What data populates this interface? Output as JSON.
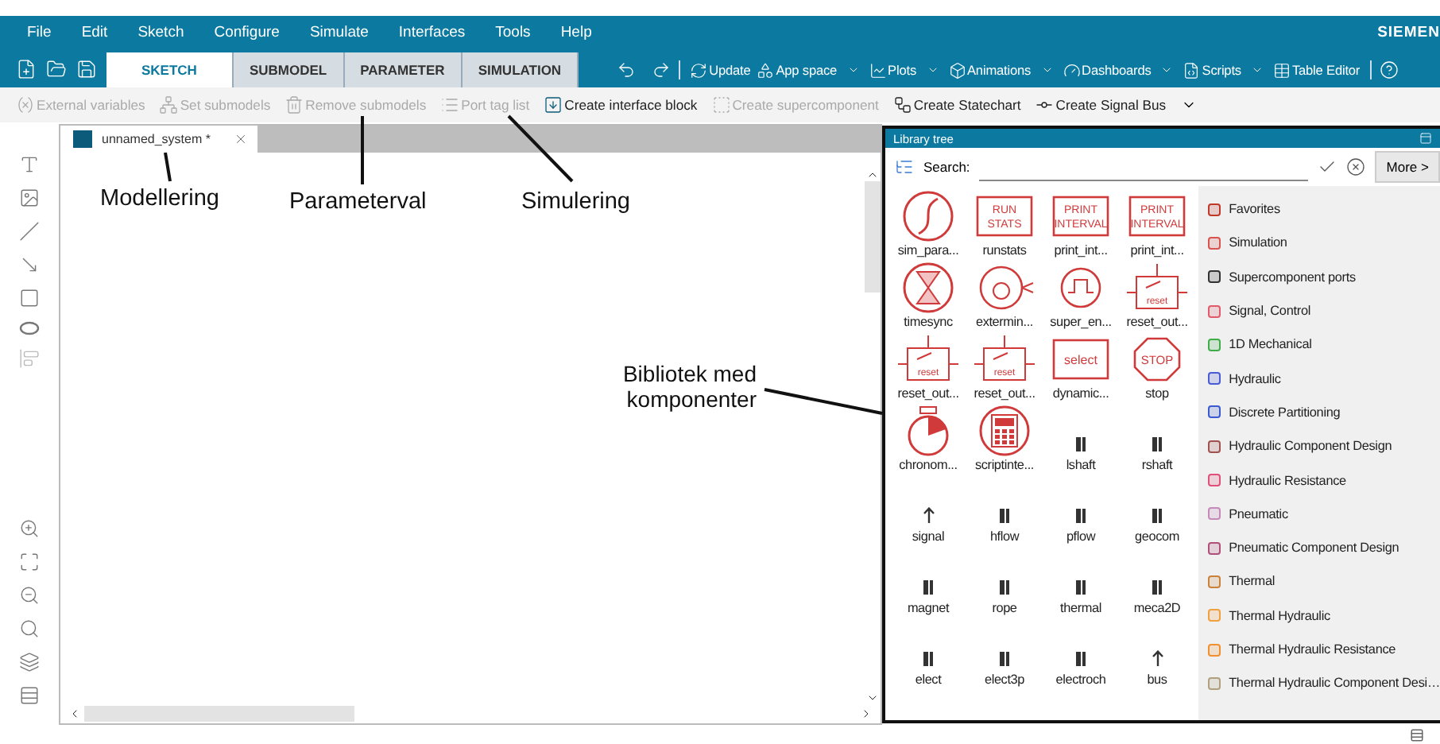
{
  "menu": [
    "File",
    "Edit",
    "Sketch",
    "Configure",
    "Simulate",
    "Interfaces",
    "Tools",
    "Help"
  ],
  "brand": "SIEMEN",
  "mode_tabs": [
    {
      "label": "SKETCH",
      "selected": true
    },
    {
      "label": "SUBMODEL",
      "selected": false
    },
    {
      "label": "PARAMETER",
      "selected": false
    },
    {
      "label": "SIMULATION",
      "selected": false
    }
  ],
  "ribbon": [
    {
      "label": "Update",
      "dropdown": false
    },
    {
      "label": "App space",
      "dropdown": true
    },
    {
      "label": "Plots",
      "dropdown": true
    },
    {
      "label": "Animations",
      "dropdown": true
    },
    {
      "label": "Dashboards",
      "dropdown": true
    },
    {
      "label": "Scripts",
      "dropdown": true
    },
    {
      "label": "Table Editor",
      "dropdown": false
    }
  ],
  "toolbar": [
    {
      "label": "External variables",
      "disabled": true
    },
    {
      "label": "Set submodels",
      "disabled": true
    },
    {
      "label": "Remove submodels",
      "disabled": true
    },
    {
      "label": "Port tag list",
      "disabled": true
    },
    {
      "label": "Create interface block",
      "disabled": false
    },
    {
      "label": "Create supercomponent",
      "disabled": true
    },
    {
      "label": "Create Statechart",
      "disabled": false
    },
    {
      "label": "Create Signal Bus",
      "disabled": false
    }
  ],
  "document_tab": {
    "title": "unnamed_system *"
  },
  "annotations": [
    {
      "text": "Modellering"
    },
    {
      "text": "Parameterval"
    },
    {
      "text": "Simulering"
    },
    {
      "text": "Bibliotek med komponenter"
    }
  ],
  "library": {
    "title": "Library tree",
    "search_label": "Search:",
    "more_button": "More >",
    "components": [
      {
        "name": "sim_para...",
        "kind": "scurve"
      },
      {
        "name": "runstats",
        "kind": "textbox",
        "icon_text": "RUN STATS"
      },
      {
        "name": "print_int...",
        "kind": "textbox",
        "icon_text": "PRINT INTERVAL"
      },
      {
        "name": "print_int...",
        "kind": "textbox",
        "icon_text": "PRINT INTERVAL"
      },
      {
        "name": "timesync",
        "kind": "hourglass"
      },
      {
        "name": "extermin...",
        "kind": "dial"
      },
      {
        "name": "super_en...",
        "kind": "pulse"
      },
      {
        "name": "reset_out...",
        "kind": "reset",
        "icon_text": "reset"
      },
      {
        "name": "reset_out...",
        "kind": "reset",
        "icon_text": "reset"
      },
      {
        "name": "reset_out...",
        "kind": "reset",
        "icon_text": "reset"
      },
      {
        "name": "dynamic...",
        "kind": "textbox",
        "icon_text": "select"
      },
      {
        "name": "stop",
        "kind": "stop",
        "icon_text": "STOP"
      },
      {
        "name": "chronom...",
        "kind": "chrono"
      },
      {
        "name": "scriptinte...",
        "kind": "calc"
      },
      {
        "name": "lshaft",
        "kind": "port"
      },
      {
        "name": "rshaft",
        "kind": "port"
      },
      {
        "name": "signal",
        "kind": "arrow"
      },
      {
        "name": "hflow",
        "kind": "port"
      },
      {
        "name": "pflow",
        "kind": "port"
      },
      {
        "name": "geocom",
        "kind": "port"
      },
      {
        "name": "magnet",
        "kind": "port"
      },
      {
        "name": "rope",
        "kind": "port"
      },
      {
        "name": "thermal",
        "kind": "port"
      },
      {
        "name": "meca2D",
        "kind": "port"
      },
      {
        "name": "elect",
        "kind": "port"
      },
      {
        "name": "elect3p",
        "kind": "port"
      },
      {
        "name": "electroch",
        "kind": "port"
      },
      {
        "name": "bus",
        "kind": "arrow"
      }
    ],
    "categories": [
      {
        "label": "Favorites",
        "color": "#c0392b"
      },
      {
        "label": "Simulation",
        "color": "#d9534f"
      },
      {
        "label": "Supercomponent ports",
        "color": "#333333"
      },
      {
        "label": "Signal, Control",
        "color": "#e05a6a"
      },
      {
        "label": "1D Mechanical",
        "color": "#3fae49"
      },
      {
        "label": "Hydraulic",
        "color": "#4a5bd6"
      },
      {
        "label": "Discrete Partitioning",
        "color": "#3a5bd0"
      },
      {
        "label": "Hydraulic Component Design",
        "color": "#a0524f"
      },
      {
        "label": "Hydraulic Resistance",
        "color": "#e0507a"
      },
      {
        "label": "Pneumatic",
        "color": "#c58ab8"
      },
      {
        "label": "Pneumatic Component Design",
        "color": "#b0507a"
      },
      {
        "label": "Thermal",
        "color": "#c8823a"
      },
      {
        "label": "Thermal Hydraulic",
        "color": "#f0a040"
      },
      {
        "label": "Thermal Hydraulic Resistance",
        "color": "#f09030"
      },
      {
        "label": "Thermal Hydraulic Component Desi…",
        "color": "#b0a080"
      }
    ]
  }
}
